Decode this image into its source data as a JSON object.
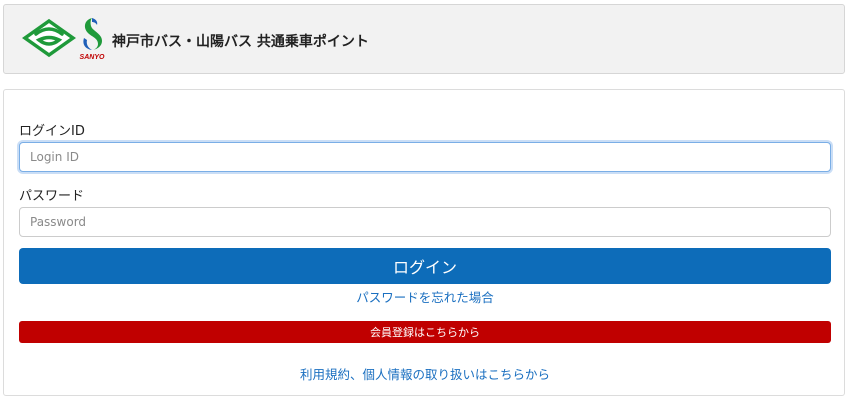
{
  "header": {
    "title": "神戸市バス・山陽バス 共通乗車ポイント",
    "sanyo_logo_text": "SANYO",
    "logos": [
      "kobe-city-logo-icon",
      "sanyo-bus-logo-icon"
    ]
  },
  "form": {
    "login_id": {
      "label": "ログインID",
      "placeholder": "Login ID",
      "value": ""
    },
    "password": {
      "label": "パスワード",
      "placeholder": "Password",
      "value": ""
    },
    "login_button_label": "ログイン",
    "forgot_password_link": "パスワードを忘れた場合",
    "register_button_label": "会員登録はこちらから",
    "terms_link": "利用規約、個人情報の取り扱いはこちらから"
  },
  "colors": {
    "login_button": "#0d6cb9",
    "register_button": "#c00000",
    "link": "#1a6fc0",
    "kobe_logo_green": "#1f9a3a",
    "sanyo_logo_green": "#1f9a3a",
    "sanyo_logo_blue": "#1e5fb8"
  }
}
